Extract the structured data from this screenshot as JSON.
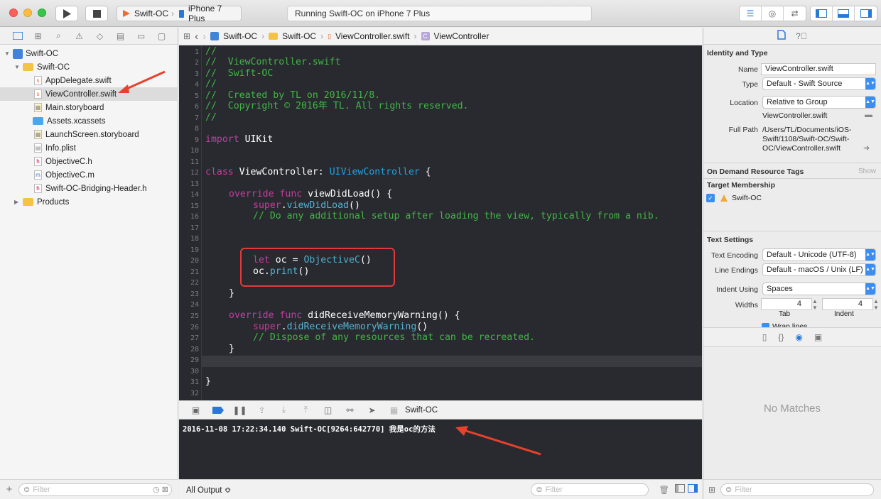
{
  "toolbar": {
    "scheme_target": "Swift-OC",
    "scheme_device": "iPhone 7 Plus",
    "status": "Running Swift-OC on iPhone 7 Plus"
  },
  "navigator": {
    "items": [
      {
        "label": "Swift-OC"
      },
      {
        "label": "Swift-OC"
      },
      {
        "label": "AppDelegate.swift"
      },
      {
        "label": "ViewController.swift"
      },
      {
        "label": "Main.storyboard"
      },
      {
        "label": "Assets.xcassets"
      },
      {
        "label": "LaunchScreen.storyboard"
      },
      {
        "label": "Info.plist"
      },
      {
        "label": "ObjectiveC.h"
      },
      {
        "label": "ObjectiveC.m"
      },
      {
        "label": "Swift-OC-Bridging-Header.h"
      },
      {
        "label": "Products"
      }
    ],
    "filter_placeholder": "Filter"
  },
  "jumpbar": {
    "crumbs": [
      "Swift-OC",
      "Swift-OC",
      "ViewController.swift",
      "ViewController"
    ]
  },
  "editor": {
    "line_numbers": [
      "1",
      "2",
      "3",
      "4",
      "5",
      "6",
      "7",
      "8",
      "9",
      "10",
      "11",
      "12",
      "13",
      "14",
      "15",
      "16",
      "17",
      "18",
      "19",
      "20",
      "21",
      "22",
      "23",
      "24",
      "25",
      "26",
      "27",
      "28",
      "29",
      "30",
      "31",
      "32"
    ],
    "lines": {
      "l1": "//",
      "l2": "//  ViewController.swift",
      "l3": "//  Swift-OC",
      "l4": "//",
      "l5": "//  Created by TL on 2016/11/8.",
      "l6": "//  Copyright © 2016年 TL. All rights reserved.",
      "l7": "//",
      "l9_kw": "import",
      "l9_rest": " UIKit",
      "l12_kw": "class",
      "l12_name": " ViewController: ",
      "l12_super": "UIViewController",
      "l12_end": " {",
      "l14_kw": "override func",
      "l14_rest": " viewDidLoad() {",
      "l15_kw": "super",
      "l15_dot": ".",
      "l15_fn": "viewDidLoad",
      "l15_end": "()",
      "l16": "// Do any additional setup after loading the view, typically from a nib.",
      "l20_kw": "let",
      "l20_mid": " oc = ",
      "l20_cls": "ObjectiveC",
      "l20_end": "()",
      "l21_a": "oc.",
      "l21_fn": "print",
      "l21_end": "()",
      "l22": "}",
      "l25_kw": "override func",
      "l25_rest": " didReceiveMemoryWarning() {",
      "l26_kw": "super",
      "l26_dot": ".",
      "l26_fn": "didReceiveMemoryWarning",
      "l26_end": "()",
      "l27": "// Dispose of any resources that can be recreated.",
      "l28": "}",
      "l31": "}"
    }
  },
  "debug": {
    "target": "Swift-OC",
    "console_text": "2016-11-08 17:22:34.140 Swift-OC[9264:642770] 我是oc的方法",
    "output_mode": "All Output ≎",
    "filter_placeholder": "Filter"
  },
  "inspector": {
    "identity_title": "Identity and Type",
    "name_label": "Name",
    "name_value": "ViewController.swift",
    "type_label": "Type",
    "type_value": "Default - Swift Source",
    "location_label": "Location",
    "location_value": "Relative to Group",
    "location_file": "ViewController.swift",
    "fullpath_label": "Full Path",
    "fullpath_value_1": "/Users/TL/Documents/iOS-",
    "fullpath_value_2": "Swift/1108/Swift-OC/Swift-",
    "fullpath_value_3": "OC/ViewController.swift",
    "odr_title": "On Demand Resource Tags",
    "odr_show": "Show",
    "target_title": "Target Membership",
    "target_name": "Swift-OC",
    "text_title": "Text Settings",
    "encoding_label": "Text Encoding",
    "encoding_value": "Default - Unicode (UTF-8)",
    "endings_label": "Line Endings",
    "endings_value": "Default - macOS / Unix (LF)",
    "indent_label": "Indent Using",
    "indent_value": "Spaces",
    "widths_label": "Widths",
    "tab_value": "4",
    "indent_width_value": "4",
    "tab_label": "Tab",
    "indent_sub_label": "Indent",
    "wrap_label": "Wrap lines",
    "no_matches": "No Matches",
    "filter_placeholder": "Filter"
  },
  "colors": {
    "editor_bg": "#292a30",
    "comment": "#41b645",
    "keyword": "#c73c9e",
    "annotation_red": "#e23a3a",
    "accent_blue": "#3b8ef0"
  }
}
